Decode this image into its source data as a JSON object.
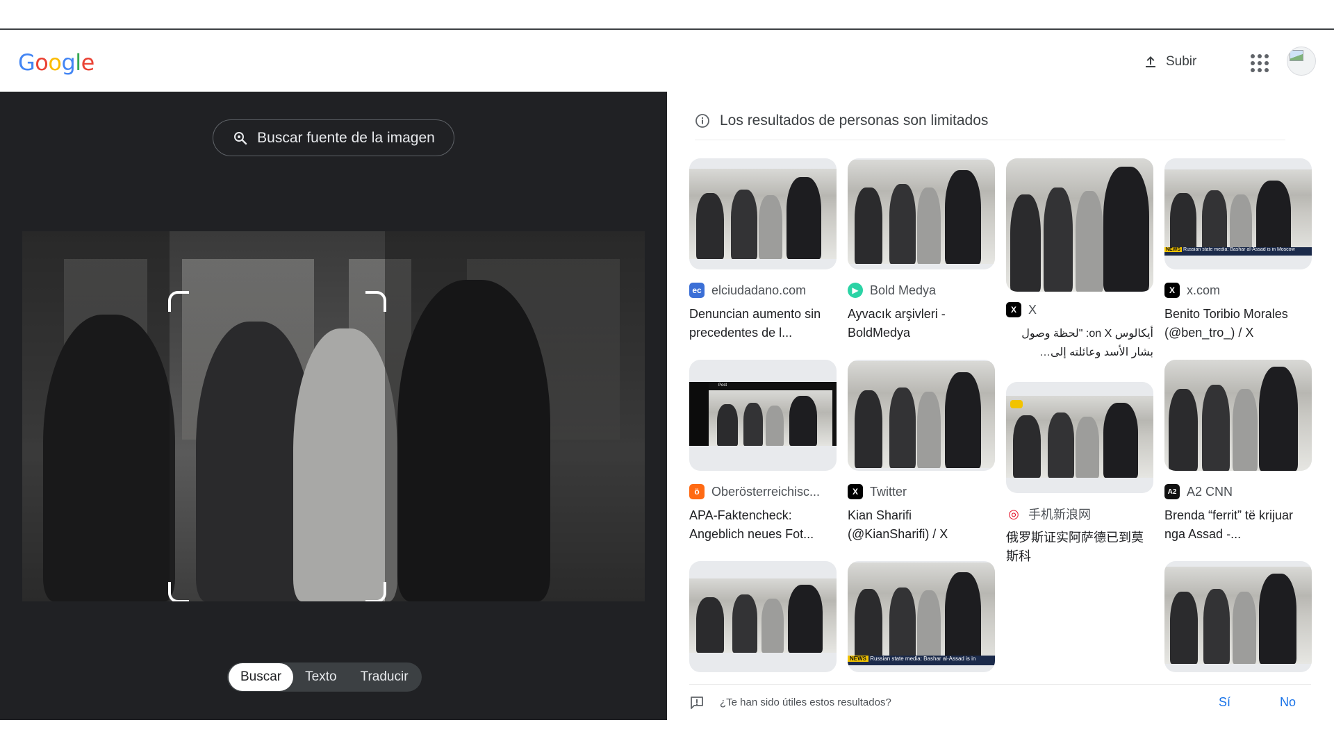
{
  "header": {
    "logo_letters": [
      {
        "ch": "G",
        "color": "#4285F4"
      },
      {
        "ch": "o",
        "color": "#EA4335"
      },
      {
        "ch": "o",
        "color": "#FBBC05"
      },
      {
        "ch": "g",
        "color": "#4285F4"
      },
      {
        "ch": "l",
        "color": "#34A853"
      },
      {
        "ch": "e",
        "color": "#EA4335"
      }
    ],
    "upload_label": "Subir",
    "upload_icon": "upload-icon",
    "apps_icon": "apps-grid-icon",
    "avatar_icon": "account-avatar"
  },
  "left_panel": {
    "source_button_label": "Buscar fuente de la imagen",
    "source_icon": "lens-search-icon",
    "modes": [
      "Buscar",
      "Texto",
      "Traducir"
    ],
    "active_mode": "Buscar"
  },
  "results": {
    "notice": "Los resultados de personas son limitados",
    "notice_icon": "info-icon",
    "cards": [
      {
        "source": "elciudadano.com",
        "fav_color": "#3b6fd6",
        "fav_text": "ec",
        "title": "Denuncian aumento sin precedentes de l..."
      },
      {
        "source": "Bold Medya",
        "fav_color": "#2bd3a5",
        "fav_text": "▶",
        "title": "Ayvacık arşivleri - BoldMedya"
      },
      {
        "source": "X",
        "fav_color": "#000000",
        "fav_text": "X",
        "title": "أيكالوس on X: \"لحظة وصول بشار الأسد وعائلته إلى موسكو..."
      },
      {
        "source": "x.com",
        "fav_color": "#000000",
        "fav_text": "X",
        "title": "Benito Toribio Morales (@ben_tro_) / X"
      },
      {
        "source": "Oberösterreichisc...",
        "fav_color": "#ff6a13",
        "fav_text": "ö",
        "title": "APA-Faktencheck: Angeblich neues Fot..."
      },
      {
        "source": "Twitter",
        "fav_color": "#000000",
        "fav_text": "X",
        "title": "Kian Sharifi (@KianSharifi) / X"
      },
      {
        "source": "手机新浪网",
        "fav_color": "#e6162d",
        "fav_text": "◎",
        "title": "俄罗斯证实阿萨德已到莫斯科"
      },
      {
        "source": "A2 CNN",
        "fav_color": "#111111",
        "fav_text": "A2",
        "title": "Brenda “ferrit” të krijuar nga Assad -..."
      }
    ],
    "overlays": {
      "news_tag": "NEWS",
      "caption_1": "Russian state media: Bashar al-Assad is in Moscow",
      "caption_2": "Russian state media: Bashar al-Assad is in"
    }
  },
  "feedback": {
    "question": "¿Te han sido útiles estos resultados?",
    "icon": "feedback-icon",
    "yes": "Sí",
    "no": "No"
  }
}
